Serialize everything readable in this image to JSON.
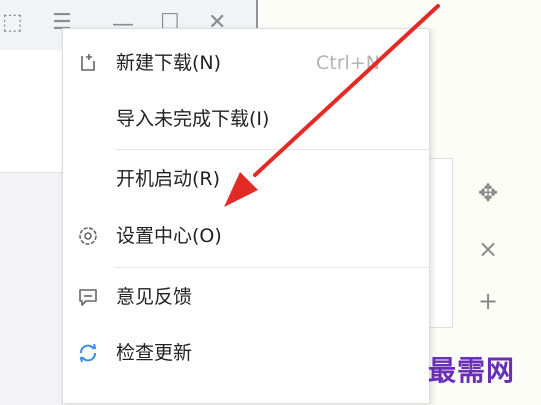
{
  "titlebar": {
    "buttons": [
      {
        "name": "skin-icon",
        "glyph": "⬚"
      },
      {
        "name": "menu-icon",
        "glyph": "☰"
      },
      {
        "name": "minimize-icon",
        "glyph": "—"
      },
      {
        "name": "maximize-icon",
        "glyph": "☐"
      },
      {
        "name": "close-icon",
        "glyph": "✕"
      }
    ]
  },
  "menu": {
    "items": [
      {
        "label": "新建下载(N)",
        "shortcut": "Ctrl+N",
        "icon": "new-download-icon"
      },
      {
        "label": "导入未完成下载(I)",
        "shortcut": "",
        "icon": ""
      },
      {
        "label": "开机启动(R)",
        "shortcut": "",
        "icon": ""
      },
      {
        "label": "设置中心(O)",
        "shortcut": "",
        "icon": "settings-icon"
      },
      {
        "label": "意见反馈",
        "shortcut": "",
        "icon": "feedback-icon"
      },
      {
        "label": "检查更新",
        "shortcut": "",
        "icon": "refresh-icon"
      }
    ]
  },
  "side_icons": [
    {
      "name": "move-icon",
      "glyph": "✥"
    },
    {
      "name": "close-icon",
      "glyph": "×"
    },
    {
      "name": "add-icon",
      "glyph": "+"
    }
  ],
  "watermark": "最需网",
  "colors": {
    "annotation_arrow": "#e32b26",
    "watermark": "#6a2fb7",
    "refresh_icon": "#3d8fe6"
  }
}
